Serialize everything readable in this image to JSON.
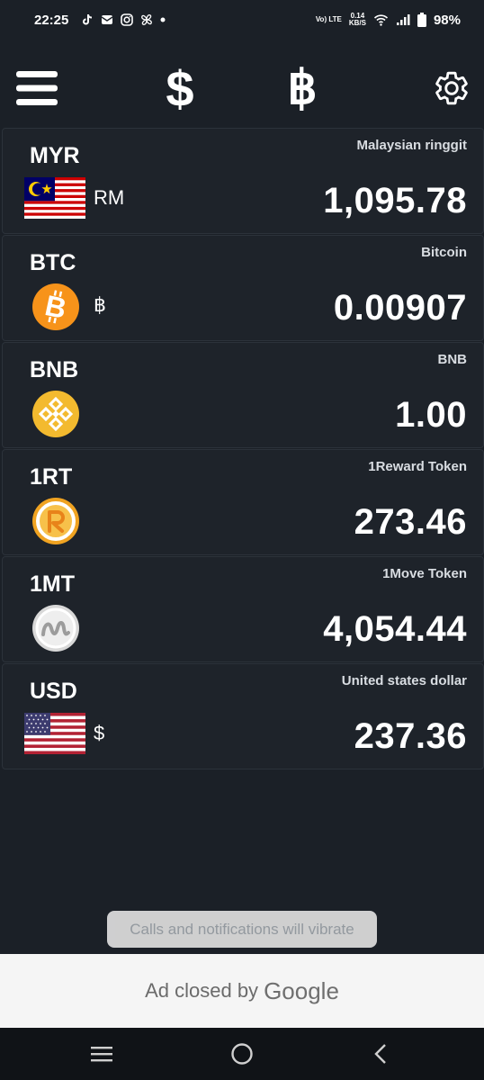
{
  "status_bar": {
    "time": "22:25",
    "volte": "Vo) LTE",
    "net_speed_value": "0.14",
    "net_speed_unit": "KB/S",
    "battery": "98%"
  },
  "toolbar": {
    "menu_icon": "hamburger-menu-icon",
    "dollar_label": "$",
    "baht_label": "฿",
    "settings_icon": "gear-icon"
  },
  "currencies": [
    {
      "code": "MYR",
      "name": "Malaysian ringgit",
      "symbol": "RM",
      "amount": "1,095.78",
      "icon": "malaysia-flag-icon"
    },
    {
      "code": "BTC",
      "name": "Bitcoin",
      "symbol": "฿",
      "amount": "0.00907",
      "icon": "bitcoin-icon"
    },
    {
      "code": "BNB",
      "name": "BNB",
      "symbol": "",
      "amount": "1.00",
      "icon": "bnb-icon"
    },
    {
      "code": "1RT",
      "name": "1Reward Token",
      "symbol": "",
      "amount": "273.46",
      "icon": "1reward-token-icon"
    },
    {
      "code": "1MT",
      "name": "1Move Token",
      "symbol": "",
      "amount": "4,054.44",
      "icon": "1move-token-icon"
    },
    {
      "code": "USD",
      "name": "United states dollar",
      "symbol": "$",
      "amount": "237.36",
      "icon": "usa-flag-icon"
    }
  ],
  "toast": {
    "text": "Calls and notifications will vibrate"
  },
  "ad": {
    "text": "Ad closed by",
    "brand": "Google"
  },
  "colors": {
    "background": "#1b2027",
    "bitcoin_orange": "#f7931a",
    "bnb_yellow": "#f3ba2f"
  }
}
